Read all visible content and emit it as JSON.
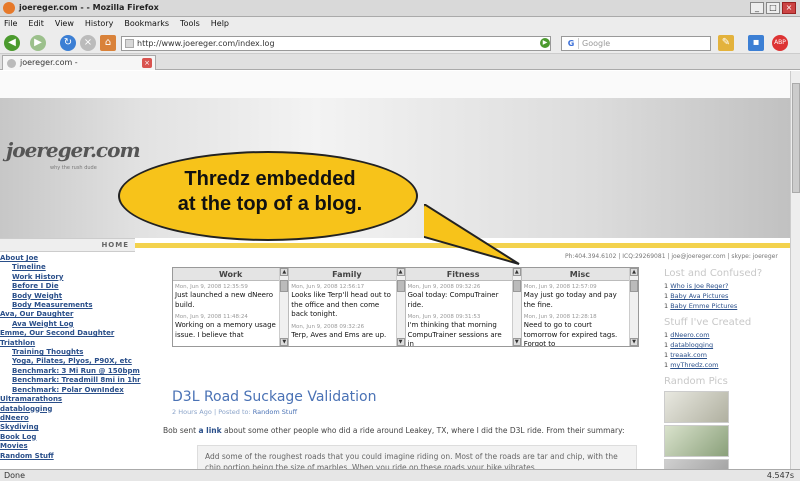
{
  "window": {
    "title": "joereger.com - - Mozilla Firefox"
  },
  "menu": [
    "File",
    "Edit",
    "View",
    "History",
    "Bookmarks",
    "Tools",
    "Help"
  ],
  "nav": {
    "url": "http://www.joereger.com/index.log",
    "search_placeholder": "Google"
  },
  "tab": {
    "label": "joereger.com -"
  },
  "status": {
    "left": "Done",
    "right": "4.547s"
  },
  "site": {
    "logo": "joereger.com",
    "logo_sub": "why the rush dude",
    "contact": "Ph:404.394.6102 | ICQ:29269081 | joe@joereger.com | skype: joereger",
    "home_label": "HOME"
  },
  "callout": {
    "line1": "Thredz embedded",
    "line2": "at the top of a blog."
  },
  "sidebar": {
    "items": [
      {
        "label": "About Joe",
        "sub": false
      },
      {
        "label": "Timeline",
        "sub": true
      },
      {
        "label": "Work History",
        "sub": true
      },
      {
        "label": "Before I Die",
        "sub": true
      },
      {
        "label": "Body Weight",
        "sub": true
      },
      {
        "label": "Body Measurements",
        "sub": true
      },
      {
        "label": "Ava, Our Daughter",
        "sub": false
      },
      {
        "label": "Ava Weight Log",
        "sub": true
      },
      {
        "label": "Emme, Our Second Daughter",
        "sub": false
      },
      {
        "label": "Triathlon",
        "sub": false
      },
      {
        "label": "Training Thoughts",
        "sub": true
      },
      {
        "label": "Yoga, Pilates, Plyos, P90X, etc",
        "sub": true
      },
      {
        "label": "Benchmark: 3 Mi Run @ 150bpm",
        "sub": true
      },
      {
        "label": "Benchmark: Treadmill 8mi in 1hr",
        "sub": true
      },
      {
        "label": "Benchmark: Polar OwnIndex",
        "sub": true
      },
      {
        "label": "Ultramarathons",
        "sub": false
      },
      {
        "label": "datablogging",
        "sub": false
      },
      {
        "label": "dNeero",
        "sub": false
      },
      {
        "label": "Skydiving",
        "sub": false
      },
      {
        "label": "Book Log",
        "sub": false
      },
      {
        "label": "Movies",
        "sub": false
      },
      {
        "label": "Random Stuff",
        "sub": false
      }
    ]
  },
  "thredz": {
    "columns": [
      {
        "title": "Work",
        "posts": [
          {
            "ts": "Mon, Jun 9, 2008 12:35:59",
            "text": "Just launched a new dNeero build."
          },
          {
            "ts": "Mon, Jun 9, 2008 11:48:24",
            "text": "Working on a memory usage issue. I believe that"
          }
        ]
      },
      {
        "title": "Family",
        "posts": [
          {
            "ts": "Mon, Jun 9, 2008 12:56:17",
            "text": "Looks like Terp'll head out to the office and then come back tonight."
          },
          {
            "ts": "Mon, Jun 9, 2008 09:32:26",
            "text": "Terp, Aves and Ems are up."
          }
        ]
      },
      {
        "title": "Fitness",
        "posts": [
          {
            "ts": "Mon, Jun 9, 2008 09:32:26",
            "text": "Goal today: CompuTrainer ride."
          },
          {
            "ts": "Mon, Jun 9, 2008 09:31:53",
            "text": "I'm thinking that morning CompuTrainer sessions are in"
          }
        ]
      },
      {
        "title": "Misc",
        "posts": [
          {
            "ts": "Mon, Jun 9, 2008 12:57:09",
            "text": "May just go today and pay the fine."
          },
          {
            "ts": "Mon, Jun 9, 2008 12:28:18",
            "text": "Need to go to court tomorrow for expired tags. Forgot to"
          }
        ]
      }
    ]
  },
  "post": {
    "title": "D3L Road Suckage Validation",
    "time": "2 Hours Ago",
    "posted_prefix": "| Posted to:",
    "category": "Random Stuff",
    "para_a": "Bob sent ",
    "para_link": "a link",
    "para_b": " about some other people who did a ride around Leakey, TX, where I did the D3L ride. From their summary:",
    "quote": "Add some of the roughest roads that you could imagine riding on. Most of the roads are tar and chip, with the chip portion being the size of marbles. When you ride on these roads your bike vibrates"
  },
  "right": {
    "lost_title": "Lost and Confused?",
    "lost_links": [
      {
        "n": "1",
        "t": "Who is Joe Reger?"
      },
      {
        "n": "1",
        "t": "Baby Ava Pictures"
      },
      {
        "n": "1",
        "t": "Baby Emme Pictures"
      }
    ],
    "created_title": "Stuff I've Created",
    "created_links": [
      {
        "n": "1",
        "t": "dNeero.com"
      },
      {
        "n": "1",
        "t": "datablogging"
      },
      {
        "n": "1",
        "t": "treaak.com"
      },
      {
        "n": "1",
        "t": "myThredz.com"
      }
    ],
    "pics_title": "Random Pics"
  },
  "colors": {
    "accent": "#f7c31a",
    "link": "#2a4f8a"
  }
}
